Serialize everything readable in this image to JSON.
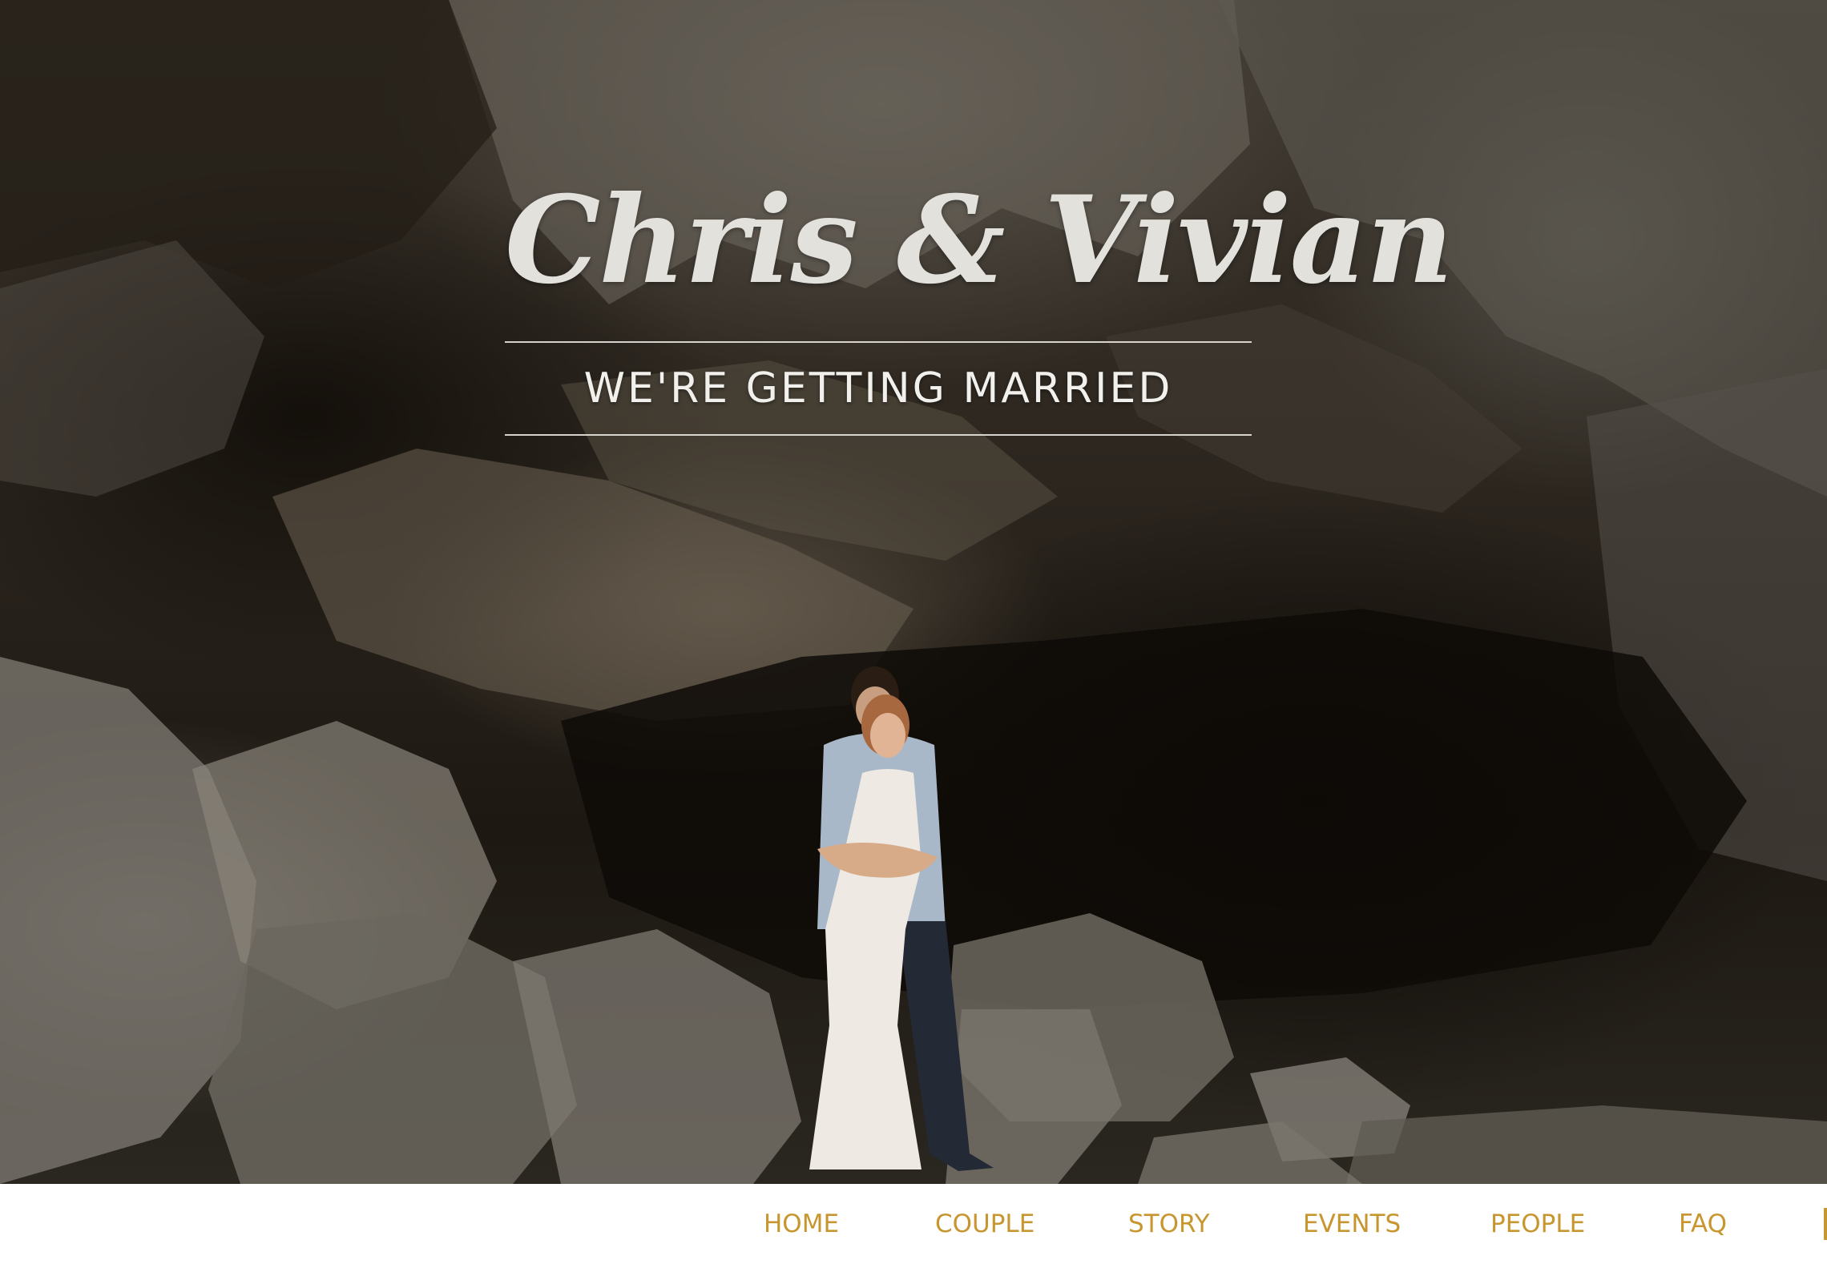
{
  "hero": {
    "title": "Chris & Vivian",
    "tagline": "WE'RE GETTING MARRIED"
  },
  "nav": {
    "items": [
      {
        "id": "home",
        "label": "HOME"
      },
      {
        "id": "couple",
        "label": "COUPLE"
      },
      {
        "id": "story",
        "label": "STORY"
      },
      {
        "id": "events",
        "label": "EVENTS"
      },
      {
        "id": "people",
        "label": "PEOPLE"
      },
      {
        "id": "faq",
        "label": "FAQ"
      }
    ]
  },
  "colors": {
    "nav_link": "#c8962f",
    "nav_background": "#ffffff",
    "title_text": "#e3e1dc"
  }
}
